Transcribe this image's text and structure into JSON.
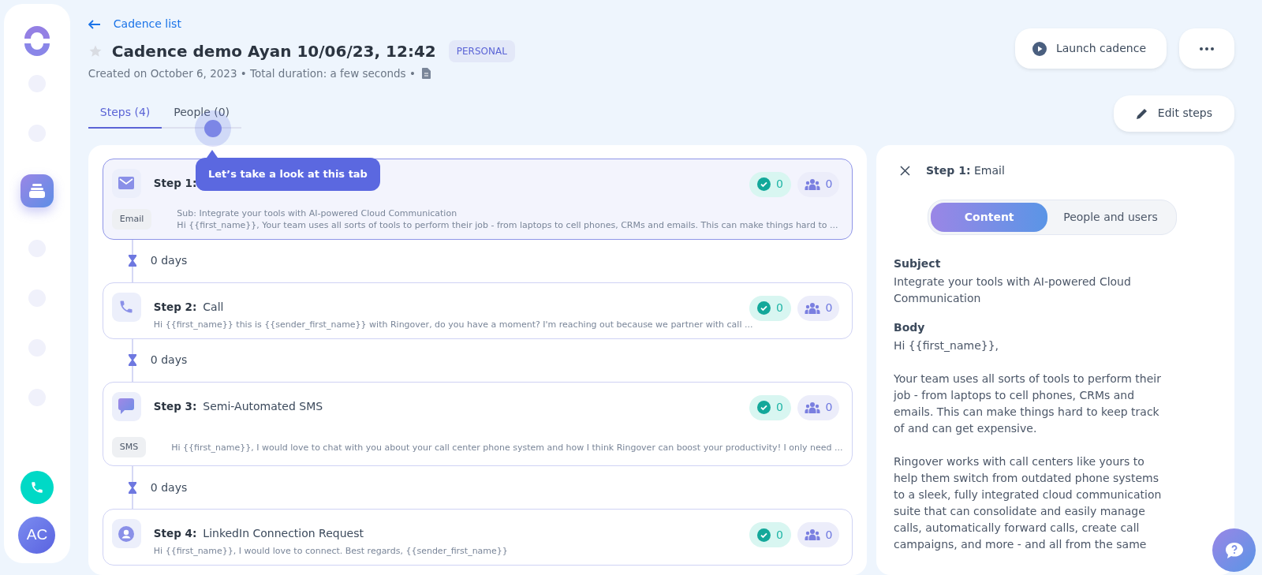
{
  "sidebar": {
    "items": [
      {
        "selected": false
      },
      {
        "selected": false
      },
      {
        "selected": true
      },
      {
        "selected": false
      },
      {
        "selected": false
      },
      {
        "selected": false
      },
      {
        "selected": false
      }
    ],
    "avatar": "AC"
  },
  "header": {
    "back_link": "Cadence list",
    "favorite": false,
    "title": "Cadence demo Ayan 10/06/23, 12:42",
    "badge": "PERSONAL",
    "subtitle": "Created on October 6, 2023 • Total duration: a few seconds •",
    "launch_button": "Launch cadence"
  },
  "tabs": [
    {
      "label": "Steps (4)",
      "selected": true
    },
    {
      "label": "People (0)",
      "selected": false
    }
  ],
  "edit_button": "Edit steps",
  "tooltip": {
    "text": "Let’s take a look at this tab"
  },
  "steps": [
    {
      "kind": "email",
      "label": "Step 1:",
      "selected": true,
      "tag": "Email",
      "subject": "Sub: Integrate your tools with AI-powered Cloud Communication",
      "preview": "Hi {{first_name}},   Your team uses all sorts of tools to perform their job - from laptops to cell phones, CRMs and emails. This can make things hard to ...",
      "done": "0",
      "people": "0",
      "delay": "0 days"
    },
    {
      "kind": "call",
      "label": "Step 2:",
      "title": "Call",
      "selected": false,
      "preview": "Hi {{first_name}} this is {{sender_first_name}} with Ringover, do you have a moment? I'm reaching out because we partner with call ...",
      "done": "0",
      "people": "0",
      "delay": "0 days"
    },
    {
      "kind": "sms",
      "label": "Step 3:",
      "title": "Semi-Automated SMS",
      "selected": false,
      "tag": "SMS",
      "preview": "Hi {{first_name}}, I would love to chat with you about your call center phone system and how I think Ringover can boost your productivity! I only need ...",
      "done": "0",
      "people": "0",
      "delay": "0 days"
    },
    {
      "kind": "linkedin",
      "label": "Step 4:",
      "title": "LinkedIn Connection Request",
      "selected": false,
      "preview": "Hi {{first_name}}, I would love to connect. Best regards, {{sender_first_name}}",
      "done": "0",
      "people": "0"
    }
  ],
  "detail": {
    "title": "**Step 1:** Email",
    "segments": [
      {
        "label": "Content",
        "selected": true
      },
      {
        "label": "People and users",
        "selected": false
      }
    ],
    "subject_label": "Subject",
    "subject": "Integrate your tools with AI-powered Cloud Communication",
    "body_label": "Body",
    "body": [
      "Hi {{first_name}},",
      "Your team uses all sorts of tools to perform their job - from laptops to cell phones, CRMs and emails. This can make things hard to keep track of and can get expensive.",
      "Ringover works with call centers like yours to help them switch from outdated phone systems to a sleek, fully integrated cloud communication suite that can consolidate and easily manage calls, automatically forward calls, create call campaigns, and more - and all from the same"
    ]
  }
}
